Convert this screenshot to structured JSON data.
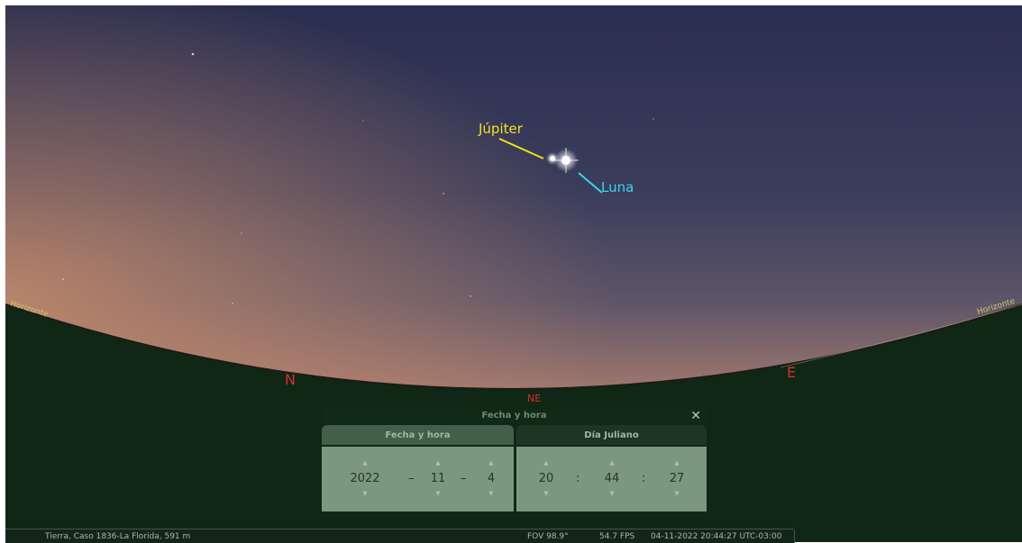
{
  "annotations": {
    "jupiter": {
      "label": "Júpiter",
      "color": "#f2e21a"
    },
    "moon": {
      "label": "Luna",
      "color": "#39d5e8"
    }
  },
  "horizon": {
    "left_label": "Horizonte",
    "right_label": "Horizonte"
  },
  "cardinals": {
    "north": "N",
    "northeast": "NE",
    "east": "E"
  },
  "dialog": {
    "title": "Fecha y hora",
    "close_glyph": "✕",
    "tabs": [
      {
        "label": "Fecha y hora"
      },
      {
        "label": "Día Juliano"
      }
    ],
    "date": {
      "year": "2022",
      "month": "11",
      "day": "4",
      "separator": "–"
    },
    "time": {
      "hour": "20",
      "minute": "44",
      "second": "27",
      "separator": ":"
    },
    "arrow_up": "▲",
    "arrow_down": "▼"
  },
  "statusbar": {
    "location": "Tierra, Caso 1836-La Florida, 591 m",
    "fov": "FOV 98.9°",
    "fps": "54.7 FPS",
    "datetime": "04-11-2022 20:44:27 UTC-03:00"
  },
  "colors": {
    "sky_top": "#2b2f4e",
    "sky_horizon": "#c98a63",
    "ground": "#0f2714",
    "cardinal": "#d8302a"
  }
}
